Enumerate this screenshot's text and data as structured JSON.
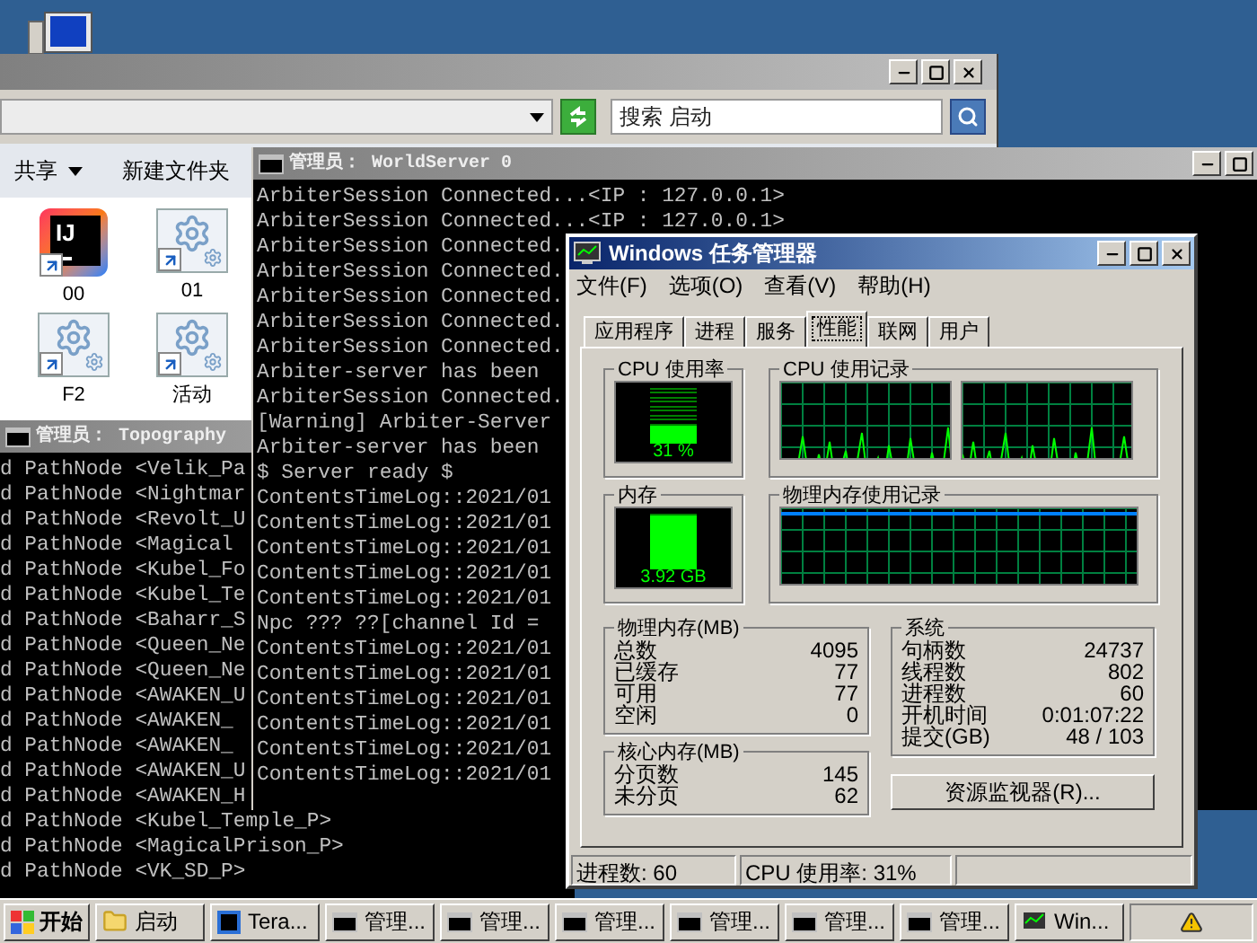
{
  "explorer": {
    "search": {
      "placeholder": "搜索 启动"
    },
    "toolbar": [
      {
        "label": "共享",
        "dropdown": true
      },
      {
        "label": "新建文件夹",
        "dropdown": false
      }
    ],
    "files": [
      {
        "name": "00",
        "kind": "intellij",
        "logo": "IJ"
      },
      {
        "name": "01",
        "kind": "settings"
      },
      {
        "name": "F2",
        "kind": "settings"
      },
      {
        "name": "活动",
        "kind": "settings"
      }
    ]
  },
  "consoles": [
    {
      "title": "管理员： Topography",
      "lines": [
        "d PathNode <Velik_Pa",
        "d PathNode <Nightmar",
        "d PathNode <Revolt_U",
        "d PathNode <Magical",
        "d PathNode <Kubel_Fo",
        "d PathNode <Kubel_Te",
        "d PathNode <Baharr_S",
        "d PathNode <Queen_Ne",
        "d PathNode <Queen_Ne",
        "d PathNode <AWAKEN_U",
        "d PathNode <AWAKEN_",
        "d PathNode <AWAKEN_",
        "d PathNode <AWAKEN_U",
        "d PathNode <AWAKEN_H",
        "d PathNode <Kubel_Temple_P>",
        "d PathNode <MagicalPrison_P>",
        "d PathNode <VK_SD_P>"
      ]
    },
    {
      "title": "管理员： WorldServer 0",
      "lines": [
        "ArbiterSession Connected...<IP : 127.0.0.1>",
        "ArbiterSession Connected...<IP : 127.0.0.1>",
        "ArbiterSession Connected.",
        "ArbiterSession Connected.",
        "ArbiterSession Connected.",
        "ArbiterSession Connected.",
        "ArbiterSession Connected.",
        "Arbiter-server has been",
        "ArbiterSession Connected.",
        "[Warning] Arbiter-Server",
        "Arbiter-server has been",
        "$ Server ready $",
        "ContentsTimeLog::2021/01",
        "ContentsTimeLog::2021/01",
        "ContentsTimeLog::2021/01",
        "ContentsTimeLog::2021/01",
        "ContentsTimeLog::2021/01",
        "Npc ??? ??[channel Id =",
        "ContentsTimeLog::2021/01",
        "ContentsTimeLog::2021/01",
        "ContentsTimeLog::2021/01",
        "ContentsTimeLog::2021/01",
        "ContentsTimeLog::2021/01",
        "ContentsTimeLog::2021/01"
      ]
    }
  ],
  "task_manager": {
    "title": "Windows 任务管理器",
    "menu": [
      "文件(F)",
      "选项(O)",
      "查看(V)",
      "帮助(H)"
    ],
    "tabs": [
      {
        "label": "应用程序",
        "selected": false
      },
      {
        "label": "进程",
        "selected": false
      },
      {
        "label": "服务",
        "selected": false
      },
      {
        "label": "性能",
        "selected": true
      },
      {
        "label": "联网",
        "selected": false
      },
      {
        "label": "用户",
        "selected": false
      }
    ],
    "cpu_usage": {
      "title": "CPU 使用率",
      "level": 0.31,
      "reading": "31 %"
    },
    "cpu_history": {
      "title": "CPU 使用记录"
    },
    "memory": {
      "title": "内存",
      "level": 0.97,
      "reading": "3.92 GB"
    },
    "memory_history": {
      "title": "物理内存使用记录"
    },
    "physical_memory": {
      "title": "物理内存(MB)",
      "rows": [
        {
          "label": "总数",
          "value": "4095"
        },
        {
          "label": "已缓存",
          "value": "77"
        },
        {
          "label": "可用",
          "value": "77"
        },
        {
          "label": "空闲",
          "value": "0"
        }
      ]
    },
    "kernel_memory": {
      "title": "核心内存(MB)",
      "rows": [
        {
          "label": "分页数",
          "value": "145"
        },
        {
          "label": "未分页",
          "value": "62"
        }
      ]
    },
    "system": {
      "title": "系统",
      "rows": [
        {
          "label": "句柄数",
          "value": "24737"
        },
        {
          "label": "线程数",
          "value": "802"
        },
        {
          "label": "进程数",
          "value": "60"
        },
        {
          "label": "开机时间",
          "value": "0:01:07:22"
        },
        {
          "label": "提交(GB)",
          "value": "48 / 103"
        }
      ]
    },
    "resource_monitor_button": "资源监视器(R)...",
    "status_bar": [
      "进程数: 60",
      "CPU 使用率: 31%"
    ]
  },
  "taskbar": {
    "start": "开始",
    "items": [
      {
        "label": "启动",
        "kind": "folder"
      },
      {
        "label": "Tera...",
        "kind": "intellij"
      },
      {
        "label": "管理...",
        "kind": "console"
      },
      {
        "label": "管理...",
        "kind": "console"
      },
      {
        "label": "管理...",
        "kind": "console"
      },
      {
        "label": "管理...",
        "kind": "console"
      },
      {
        "label": "管理...",
        "kind": "console"
      },
      {
        "label": "管理...",
        "kind": "console"
      },
      {
        "label": "Win...",
        "kind": "taskmgr"
      }
    ]
  }
}
